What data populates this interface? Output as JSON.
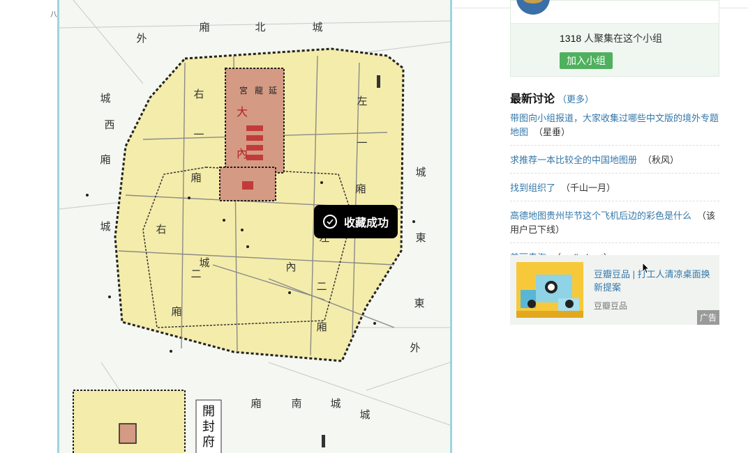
{
  "map": {
    "corner_label": "八",
    "districts": [
      "廂",
      "北",
      "城",
      "外",
      "城",
      "西",
      "廂",
      "右",
      "一",
      "右",
      "城",
      "二",
      "城",
      "廂",
      "左",
      "一",
      "廂",
      "東",
      "左",
      "內",
      "二",
      "廂",
      "城",
      "東",
      "廂",
      "外",
      "南",
      "城",
      "廂",
      "城"
    ],
    "palace_labels": [
      "宮",
      "龍",
      "延",
      "大",
      "內"
    ],
    "legend_title": [
      "開",
      "封",
      "府"
    ]
  },
  "toast": {
    "text": "收藏成功"
  },
  "group": {
    "member_count": "1318",
    "member_suffix": " 人聚集在这个小组",
    "join_label": "加入小组"
  },
  "discussions": {
    "title": "最新讨论",
    "more_open": "（",
    "more_label": "更多",
    "more_close": "）",
    "items": [
      {
        "title": "带图向小组报道，大家收集过哪些中文版的境外专题地图",
        "author": "（星垂）"
      },
      {
        "title": "求推荐一本比较全的中国地图册",
        "author": "（秋风）"
      },
      {
        "title": "找到组织了",
        "author": "（千山一月）"
      },
      {
        "title": "高德地图贵州毕节这个飞机后边的彩色是什么",
        "author": "（该用户已下线）"
      },
      {
        "title": "美丽青海",
        "author": "（realbobcat）"
      }
    ]
  },
  "ad": {
    "title": "豆瓣豆品 | 打工人清凉桌面换新提案",
    "source": "豆瓣豆品",
    "badge": "广告"
  },
  "colors": {
    "map_fill": "#f4ecaa",
    "palace_fill": "#d49a84",
    "link": "#3377aa",
    "join_green": "#4fb05e",
    "toast_bg": "#000000"
  }
}
